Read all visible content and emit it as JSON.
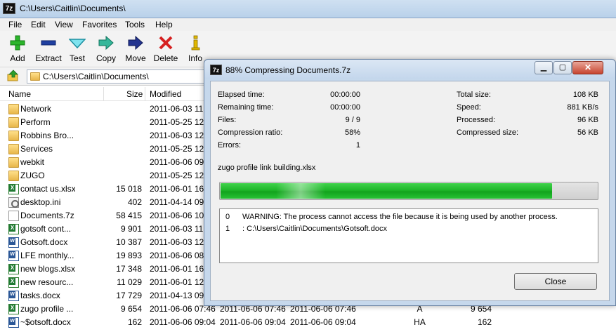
{
  "main_window": {
    "title": "C:\\Users\\Caitlin\\Documents\\",
    "app_icon": "7z"
  },
  "menu": [
    "File",
    "Edit",
    "View",
    "Favorites",
    "Tools",
    "Help"
  ],
  "toolbar": [
    {
      "label": "Add",
      "icon": "plus-icon",
      "color": "#2bb52b"
    },
    {
      "label": "Extract",
      "icon": "minus-icon",
      "color": "#1f3fa0"
    },
    {
      "label": "Test",
      "icon": "check-icon",
      "color": "#2ab3c4"
    },
    {
      "label": "Copy",
      "icon": "copy-arrow-icon",
      "color": "#2aa58a"
    },
    {
      "label": "Move",
      "icon": "move-arrow-icon",
      "color": "#1f2f8f"
    },
    {
      "label": "Delete",
      "icon": "delete-x-icon",
      "color": "#d62020"
    },
    {
      "label": "Info",
      "icon": "info-icon",
      "color": "#e0b800"
    }
  ],
  "address": {
    "path": "C:\\Users\\Caitlin\\Documents\\"
  },
  "columns": {
    "name": "Name",
    "size": "Size",
    "modified": "Modified"
  },
  "files": [
    {
      "name": "Network",
      "size": "",
      "modified": "2011-06-03 11:",
      "created": "",
      "accessed": "",
      "attr": "",
      "packed": "",
      "type": "folder"
    },
    {
      "name": "Perform",
      "size": "",
      "modified": "2011-05-25 12:",
      "created": "",
      "accessed": "",
      "attr": "",
      "packed": "",
      "type": "folder"
    },
    {
      "name": "Robbins Bro...",
      "size": "",
      "modified": "2011-06-03 12:",
      "created": "",
      "accessed": "",
      "attr": "",
      "packed": "",
      "type": "folder"
    },
    {
      "name": "Services",
      "size": "",
      "modified": "2011-05-25 12:",
      "created": "",
      "accessed": "",
      "attr": "",
      "packed": "",
      "type": "folder"
    },
    {
      "name": "webkit",
      "size": "",
      "modified": "2011-06-06 09:",
      "created": "",
      "accessed": "",
      "attr": "",
      "packed": "",
      "type": "folder"
    },
    {
      "name": "ZUGO",
      "size": "",
      "modified": "2011-05-25 12:",
      "created": "",
      "accessed": "",
      "attr": "",
      "packed": "",
      "type": "folder"
    },
    {
      "name": "contact us.xlsx",
      "size": "15 018",
      "modified": "2011-06-01 16:",
      "created": "",
      "accessed": "",
      "attr": "",
      "packed": "",
      "type": "xlsx"
    },
    {
      "name": "desktop.ini",
      "size": "402",
      "modified": "2011-04-14 09:",
      "created": "",
      "accessed": "",
      "attr": "",
      "packed": "",
      "type": "ini"
    },
    {
      "name": "Documents.7z",
      "size": "58 415",
      "modified": "2011-06-06 10:",
      "created": "",
      "accessed": "",
      "attr": "",
      "packed": "",
      "type": "7z"
    },
    {
      "name": "gotsoft cont...",
      "size": "9 901",
      "modified": "2011-06-03 11:",
      "created": "",
      "accessed": "",
      "attr": "",
      "packed": "",
      "type": "xlsx"
    },
    {
      "name": "Gotsoft.docx",
      "size": "10 387",
      "modified": "2011-06-03 12:",
      "created": "",
      "accessed": "",
      "attr": "",
      "packed": "",
      "type": "docx"
    },
    {
      "name": "LFE monthly...",
      "size": "19 893",
      "modified": "2011-06-06 08:",
      "created": "",
      "accessed": "",
      "attr": "",
      "packed": "",
      "type": "docx"
    },
    {
      "name": "new blogs.xlsx",
      "size": "17 348",
      "modified": "2011-06-01 16:",
      "created": "",
      "accessed": "",
      "attr": "",
      "packed": "",
      "type": "xlsx"
    },
    {
      "name": "new resourc...",
      "size": "11 029",
      "modified": "2011-06-01 12:",
      "created": "",
      "accessed": "",
      "attr": "",
      "packed": "",
      "type": "xlsx"
    },
    {
      "name": "tasks.docx",
      "size": "17 729",
      "modified": "2011-04-13 09:",
      "created": "",
      "accessed": "",
      "attr": "",
      "packed": "",
      "type": "docx"
    },
    {
      "name": "zugo profile ...",
      "size": "9 654",
      "modified": "2011-06-06 07:46",
      "created": "2011-06-06 07:46",
      "accessed": "2011-06-06 07:46",
      "attr": "A",
      "packed": "9 654",
      "type": "xlsx"
    },
    {
      "name": "~$otsoft.docx",
      "size": "162",
      "modified": "2011-06-06 09:04",
      "created": "2011-06-06 09:04",
      "accessed": "2011-06-06 09:04",
      "attr": "HA",
      "packed": "162",
      "type": "docx"
    }
  ],
  "dialog": {
    "title": "88% Compressing Documents.7z",
    "app_icon": "7z",
    "stats_left": [
      {
        "label": "Elapsed time:",
        "value": "00:00:00"
      },
      {
        "label": "Remaining time:",
        "value": "00:00:00"
      },
      {
        "label": "Files:",
        "value": "9 / 9"
      },
      {
        "label": "Compression ratio:",
        "value": "58%"
      },
      {
        "label": "Errors:",
        "value": "1"
      }
    ],
    "stats_right": [
      {
        "label": "Total size:",
        "value": "108 KB"
      },
      {
        "label": "Speed:",
        "value": "881 KB/s"
      },
      {
        "label": "Processed:",
        "value": "96 KB"
      },
      {
        "label": "Compressed size:",
        "value": "56 KB"
      }
    ],
    "current_file": "zugo profile link building.xlsx",
    "progress_percent": 88,
    "messages": [
      {
        "index": "0",
        "text": "WARNING: The process cannot access the file because it is being used by another process."
      },
      {
        "index": "1",
        "text": ": C:\\Users\\Caitlin\\Documents\\Gotsoft.docx"
      }
    ],
    "close_label": "Close"
  }
}
